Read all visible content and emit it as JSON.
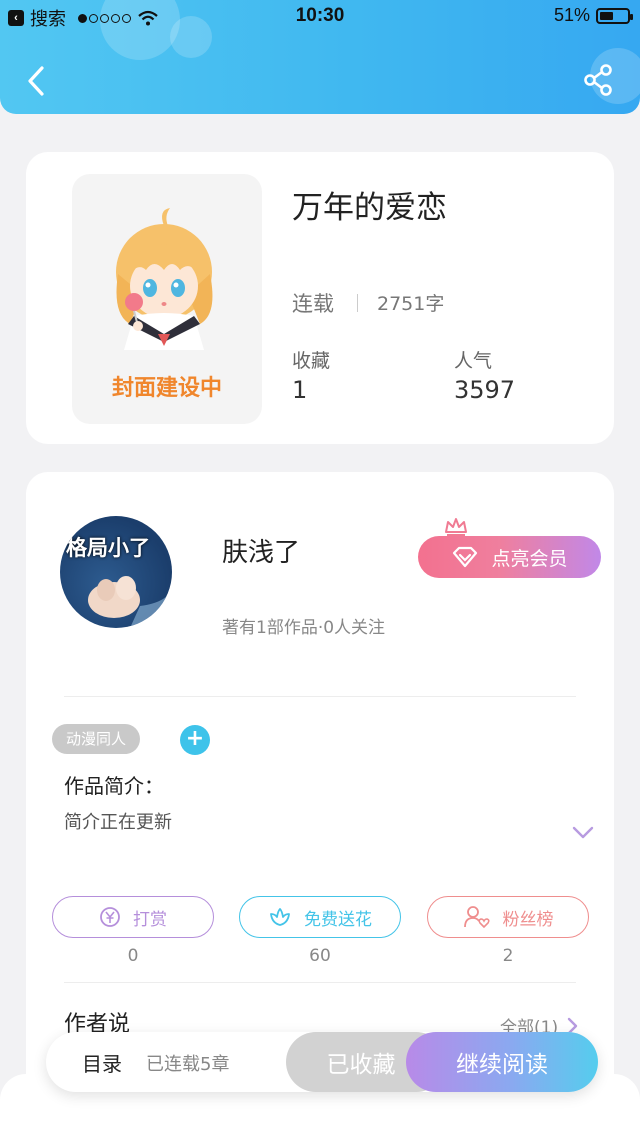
{
  "status_bar": {
    "back_app": "搜索",
    "time": "10:30",
    "battery": "51%",
    "battery_level": 0.51
  },
  "book": {
    "cover_text": "封面建设中",
    "title": "万年的爱恋",
    "status": "连载",
    "word_count": "2751字",
    "stats": [
      {
        "label": "收藏",
        "value": "1"
      },
      {
        "label": "人气",
        "value": "3597"
      }
    ]
  },
  "author": {
    "avatar_text": "格局小了",
    "name": "肤浅了",
    "meta": "著有1部作品·0人关注",
    "vip_label": "点亮会员"
  },
  "details": {
    "tag": "动漫同人",
    "add_tag": "+",
    "intro_title": "作品简介：",
    "intro_text": "简介正在更新"
  },
  "actions": [
    {
      "label": "打赏",
      "count": "0",
      "color": "#b58fdb",
      "icon": "yen-coin-icon"
    },
    {
      "label": "免费送花",
      "count": "60",
      "color": "#44c4e8",
      "icon": "flower-icon"
    },
    {
      "label": "粉丝榜",
      "count": "2",
      "color": "#ef8e8e",
      "icon": "fans-rank-icon"
    }
  ],
  "author_says": {
    "title": "作者说",
    "see_all": "全部(1)"
  },
  "bottom_bar": {
    "toc": "目录",
    "chapters": "已连载5章",
    "collected": "已收藏",
    "continue": "继续阅读"
  }
}
